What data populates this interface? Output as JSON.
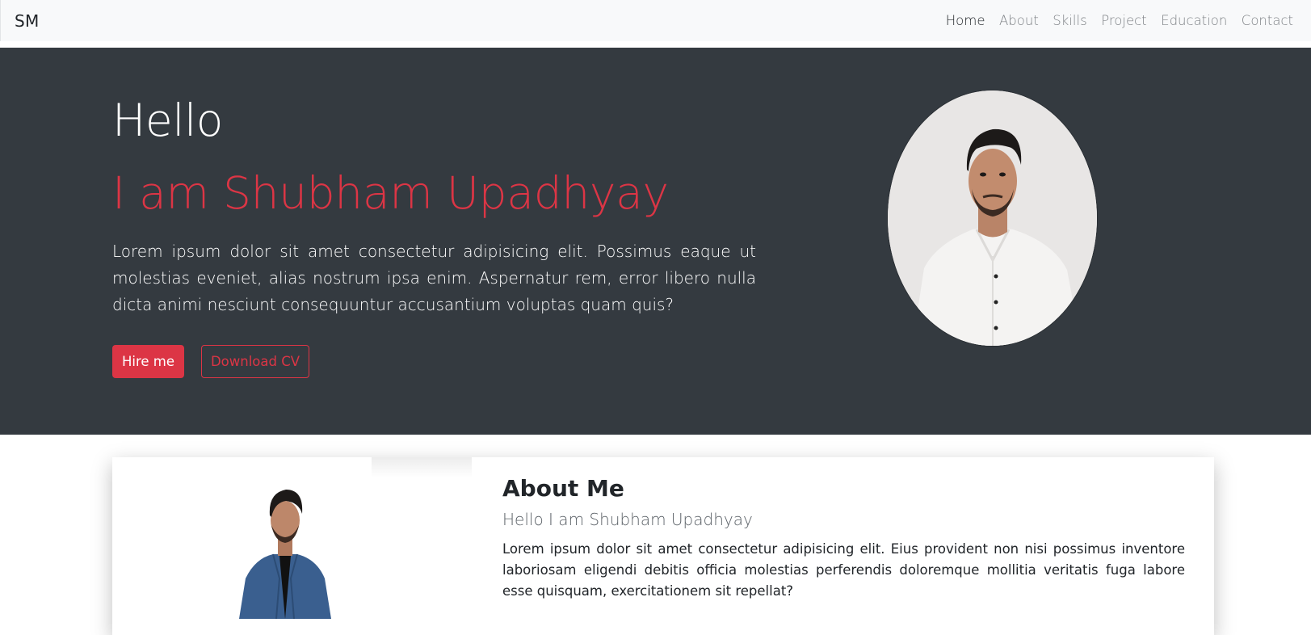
{
  "navbar": {
    "brand": "SM",
    "links": [
      "Home",
      "About",
      "Skills",
      "Project",
      "Education",
      "Contact"
    ],
    "active": "Home"
  },
  "hero": {
    "greeting": "Hello",
    "name": "I am Shubham Upadhyay",
    "description": "Lorem ipsum dolor sit amet consectetur adipisicing elit. Possimus eaque ut molestias eveniet, alias nostrum ipsa enim. Aspernatur rem, error libero nulla dicta animi nesciunt consequuntur accusantium voluptas quam quis?",
    "hire_button": "Hire me",
    "cv_button": "Download CV"
  },
  "about": {
    "title": "About Me",
    "subtitle": "Hello I am Shubham Upadhyay",
    "description": "Lorem ipsum dolor sit amet consectetur adipisicing elit. Eius provident non nisi possimus inventore laboriosam eligendi debitis officia molestias perferendis doloremque mollitia veritatis fuga labore esse quisquam, exercitationem sit repellat?"
  },
  "colors": {
    "accent": "#dc3545",
    "hero_bg": "#343a40",
    "navbar_bg": "#f8f9fa"
  }
}
